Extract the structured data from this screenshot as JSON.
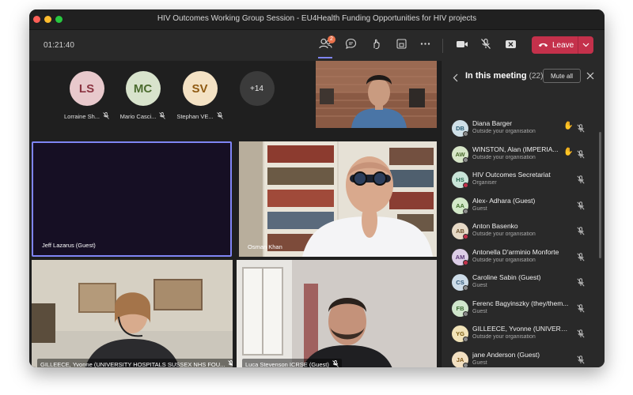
{
  "window": {
    "title": "HIV Outcomes Working Group Session - EU4Health Funding Opportunities for HIV projects"
  },
  "toolbar": {
    "timer": "01:21:40",
    "people_badge": "2",
    "leave_label": "Leave",
    "icons": [
      "people-icon",
      "chat-icon",
      "reactions-icon",
      "share-tray-icon",
      "more-icon",
      "camera-icon",
      "mic-off-icon",
      "share-icon",
      "phone-icon",
      "chevron-down-icon"
    ]
  },
  "avatar_strip": {
    "participants": [
      {
        "initials": "LS",
        "name": "Lorraine Sh...",
        "bg": "#e8c9cc",
        "fg": "#8a3340"
      },
      {
        "initials": "MC",
        "name": "Mario Casci...",
        "bg": "#d8e3cc",
        "fg": "#4b6b2e"
      },
      {
        "initials": "SV",
        "name": "Stephan VE...",
        "bg": "#f4e2c4",
        "fg": "#8f5a12"
      }
    ],
    "more_label": "+14"
  },
  "tiles": {
    "jeff": "Jeff Lazarus (Guest)",
    "osman": "Osman Khan",
    "gilleece": "GILLEECE, Yvonne (UNIVERSITY HOSPITALS SUSSEX NHS FOU...",
    "luca": "Luca Stevenson ICRSE (Guest)"
  },
  "panel": {
    "title": "In this meeting",
    "count": "(22)",
    "mute_all": "Mute all",
    "participants": [
      {
        "initials": "DB",
        "name": "Diana Barger",
        "sub": "Outside your organisation",
        "hand": true,
        "bg": "#cfe0e8",
        "fg": "#2b5e75",
        "status": "#8a8a8a"
      },
      {
        "initials": "AW",
        "name": "WINSTON, Alan (IMPERIA...",
        "sub": "Outside your organisation",
        "hand": true,
        "bg": "#d7e6c8",
        "fg": "#4a6b2c",
        "status": "#8a8a8a"
      },
      {
        "initials": "HS",
        "name": "HIV Outcomes Secretariat",
        "sub": "Organiser",
        "hand": false,
        "bg": "#c9e4d8",
        "fg": "#2c6b52",
        "status": "#c4314b"
      },
      {
        "initials": "AA",
        "name": "Alex- Adhara (Guest)",
        "sub": "Guest",
        "hand": false,
        "bg": "#d2e8c8",
        "fg": "#3f6e2a",
        "status": "#8a8a8a"
      },
      {
        "initials": "AB",
        "name": "Anton Basenko",
        "sub": "Outside your organisation",
        "hand": false,
        "bg": "#e6d9c6",
        "fg": "#6e5330",
        "status": "#c4314b"
      },
      {
        "initials": "AM",
        "name": "Antonella D'arminio Monforte",
        "sub": "Outside your organisation",
        "hand": false,
        "bg": "#dccde6",
        "fg": "#5d3a78",
        "status": "#c4314b"
      },
      {
        "initials": "CS",
        "name": "Caroline Sabin (Guest)",
        "sub": "Guest",
        "hand": false,
        "bg": "#cddce8",
        "fg": "#2f5677",
        "status": "#8a8a8a"
      },
      {
        "initials": "FB",
        "name": "Ferenc Bagyinszky (they/them...",
        "sub": "Guest",
        "hand": false,
        "bg": "#d0e6cc",
        "fg": "#3d6c33",
        "status": "#8a8a8a"
      },
      {
        "initials": "YG",
        "name": "GILLEECE, Yvonne (UNIVERSIT...",
        "sub": "Outside your organisation",
        "hand": false,
        "bg": "#f1e3b8",
        "fg": "#7a5b0f",
        "status": "#8a8a8a"
      },
      {
        "initials": "JA",
        "name": "jane Anderson (Guest)",
        "sub": "Guest",
        "hand": false,
        "bg": "#f2e0c2",
        "fg": "#7d5716",
        "status": "#8a8a8a"
      }
    ]
  },
  "colors": {
    "accent": "#7f85f5",
    "leave": "#c4314b",
    "active_speaker_border": "#7f85f5"
  }
}
